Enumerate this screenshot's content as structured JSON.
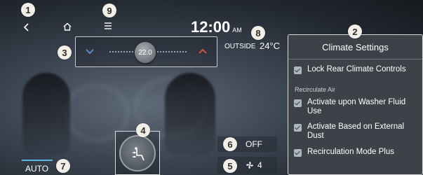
{
  "top_bar": {
    "clock_time": "12:00",
    "clock_period": "AM",
    "icons": [
      "back-icon",
      "home-icon",
      "menu-icon"
    ]
  },
  "outside_temperature": {
    "label": "OUTSIDE",
    "value": "24°C"
  },
  "temperature_control": {
    "setpoint": "22.0",
    "down_icon": "chevron-down-icon",
    "up_icon": "chevron-up-icon",
    "down_color": "#5f8fd4",
    "up_color": "#e2553f"
  },
  "climate_panel": {
    "title": "Climate Settings",
    "lock_rear": {
      "label": "Lock Rear Climate Controls",
      "checked": true
    },
    "section_label": "Recirculate Air",
    "options": [
      {
        "label": "Activate upon Washer Fluid Use",
        "checked": true
      },
      {
        "label": "Activate Based on External Dust",
        "checked": true
      },
      {
        "label": "Recirculation Mode Plus",
        "checked": true
      }
    ]
  },
  "airflow": {
    "icon": "seat-airflow-icon"
  },
  "controls": {
    "off_label": "OFF",
    "fan_level": "4",
    "fan_icon": "fan-icon",
    "auto_label": "AUTO",
    "auto_indicator_color": "#5fb3e3"
  },
  "callouts": [
    "1",
    "2",
    "3",
    "4",
    "5",
    "6",
    "7",
    "8",
    "9"
  ]
}
